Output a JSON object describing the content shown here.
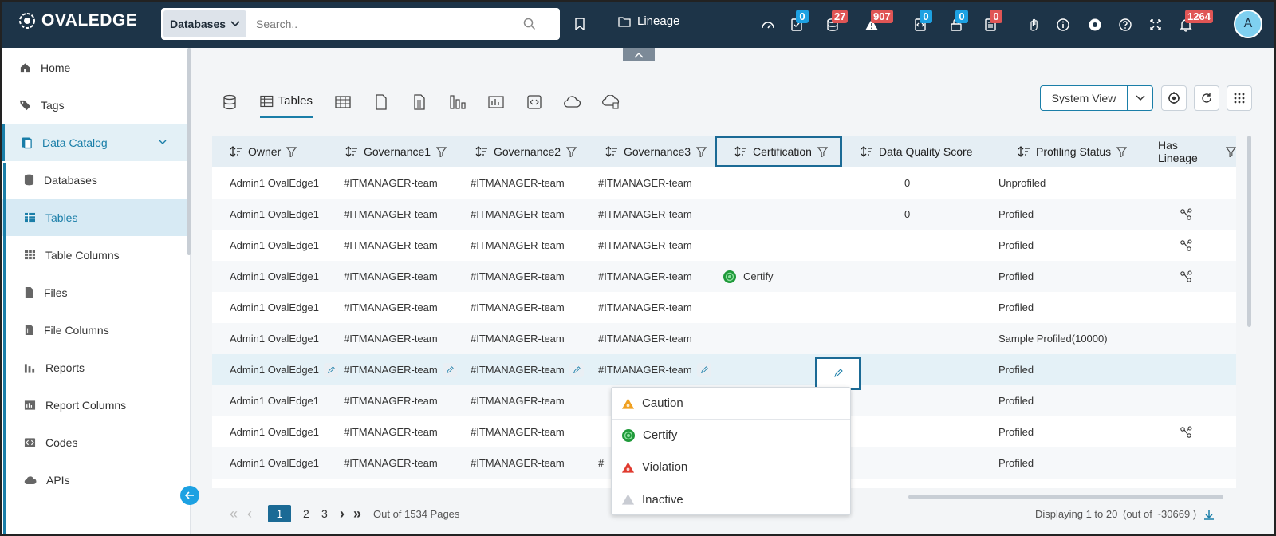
{
  "app": {
    "brand": "OVALEDGE"
  },
  "search": {
    "category": "Databases",
    "placeholder": "Search.."
  },
  "header": {
    "lineage_label": "Lineage",
    "badges": [
      {
        "icon": "dashboard-icon",
        "count": null
      },
      {
        "icon": "query-sheet-icon",
        "count": "0",
        "color": "#1da1e2"
      },
      {
        "icon": "database-icon",
        "count": "27",
        "color": "#e05555"
      },
      {
        "icon": "alert-icon",
        "count": "907",
        "color": "#e05555"
      },
      {
        "icon": "code-file-icon",
        "count": "0",
        "color": "#1da1e2"
      },
      {
        "icon": "lock-icon",
        "count": "0",
        "color": "#1da1e2"
      },
      {
        "icon": "task-list-icon",
        "count": "0",
        "color": "#e05555"
      },
      {
        "icon": "notification-bell-icon",
        "count": "1264",
        "color": "#e05555"
      }
    ],
    "avatar_initial": "A"
  },
  "sidebar": {
    "items": [
      {
        "label": "Home",
        "icon": "home-icon"
      },
      {
        "label": "Tags",
        "icon": "tag-icon"
      },
      {
        "label": "Data Catalog",
        "icon": "catalog-icon"
      },
      {
        "label": "Databases",
        "icon": "database-icon"
      },
      {
        "label": "Tables",
        "icon": "table-icon"
      },
      {
        "label": "Table Columns",
        "icon": "table-columns-icon"
      },
      {
        "label": "Files",
        "icon": "file-icon"
      },
      {
        "label": "File Columns",
        "icon": "file-columns-icon"
      },
      {
        "label": "Reports",
        "icon": "report-icon"
      },
      {
        "label": "Report Columns",
        "icon": "report-columns-icon"
      },
      {
        "label": "Codes",
        "icon": "code-icon"
      },
      {
        "label": "APIs",
        "icon": "cloud-api-icon"
      }
    ]
  },
  "tabs": {
    "active_label": "Tables"
  },
  "toolbar": {
    "view_label": "System View"
  },
  "columns": {
    "owner": "Owner",
    "gov1": "Governance1",
    "gov2": "Governance2",
    "gov3": "Governance3",
    "cert": "Certification",
    "dq": "Data Quality Score",
    "profiling": "Profiling Status",
    "lineage": "Has Lineage"
  },
  "rows": [
    {
      "owner": "Admin1 OvalEdge1",
      "gov1": "#ITMANAGER-team",
      "gov2": "#ITMANAGER-team",
      "gov3": "#ITMANAGER-team",
      "cert": "",
      "dq": "0",
      "profiling": "Unprofiled",
      "lineage": false
    },
    {
      "owner": "Admin1 OvalEdge1",
      "gov1": "#ITMANAGER-team",
      "gov2": "#ITMANAGER-team",
      "gov3": "#ITMANAGER-team",
      "cert": "",
      "dq": "0",
      "profiling": "Profiled",
      "lineage": true
    },
    {
      "owner": "Admin1 OvalEdge1",
      "gov1": "#ITMANAGER-team",
      "gov2": "#ITMANAGER-team",
      "gov3": "#ITMANAGER-team",
      "cert": "",
      "dq": "",
      "profiling": "Profiled",
      "lineage": true
    },
    {
      "owner": "Admin1 OvalEdge1",
      "gov1": "#ITMANAGER-team",
      "gov2": "#ITMANAGER-team",
      "gov3": "#ITMANAGER-team",
      "cert": "Certify",
      "dq": "",
      "profiling": "Profiled",
      "lineage": true
    },
    {
      "owner": "Admin1 OvalEdge1",
      "gov1": "#ITMANAGER-team",
      "gov2": "#ITMANAGER-team",
      "gov3": "#ITMANAGER-team",
      "cert": "",
      "dq": "",
      "profiling": "Profiled",
      "lineage": false
    },
    {
      "owner": "Admin1 OvalEdge1",
      "gov1": "#ITMANAGER-team",
      "gov2": "#ITMANAGER-team",
      "gov3": "#ITMANAGER-team",
      "cert": "",
      "dq": "",
      "profiling": "Sample Profiled(10000)",
      "lineage": false
    },
    {
      "owner": "Admin1 OvalEdge1",
      "gov1": "#ITMANAGER-team",
      "gov2": "#ITMANAGER-team",
      "gov3": "#ITMANAGER-team",
      "cert": "",
      "dq": "",
      "profiling": "Profiled",
      "lineage": false
    },
    {
      "owner": "Admin1 OvalEdge1",
      "gov1": "#ITMANAGER-team",
      "gov2": "#ITMANAGER-team",
      "gov3": "",
      "cert": "",
      "dq": "",
      "profiling": "Profiled",
      "lineage": false
    },
    {
      "owner": "Admin1 OvalEdge1",
      "gov1": "#ITMANAGER-team",
      "gov2": "#ITMANAGER-team",
      "gov3": "",
      "cert": "",
      "dq": "",
      "profiling": "Profiled",
      "lineage": true
    },
    {
      "owner": "Admin1 OvalEdge1",
      "gov1": "#ITMANAGER-team",
      "gov2": "#ITMANAGER-team",
      "gov3": "#",
      "cert": "",
      "dq": "",
      "profiling": "Profiled",
      "lineage": false
    }
  ],
  "certification_menu": [
    {
      "label": "Caution",
      "icon": "caution-icon",
      "color": "#f0a020"
    },
    {
      "label": "Certify",
      "icon": "certify-icon",
      "color": "#1f9a3a"
    },
    {
      "label": "Violation",
      "icon": "violation-icon",
      "color": "#e03a2f"
    },
    {
      "label": "Inactive",
      "icon": "inactive-icon",
      "color": "#c9ccd3"
    }
  ],
  "pager": {
    "pages": [
      "1",
      "2",
      "3"
    ],
    "current": "1",
    "total_text": "Out of 1534 Pages",
    "displaying": "Displaying 1 to 20",
    "out_of": "(out of ~30669 )"
  },
  "colors": {
    "topbar": "#1d3448",
    "accent": "#1a7ea8",
    "highlight": "#1b6a95"
  }
}
